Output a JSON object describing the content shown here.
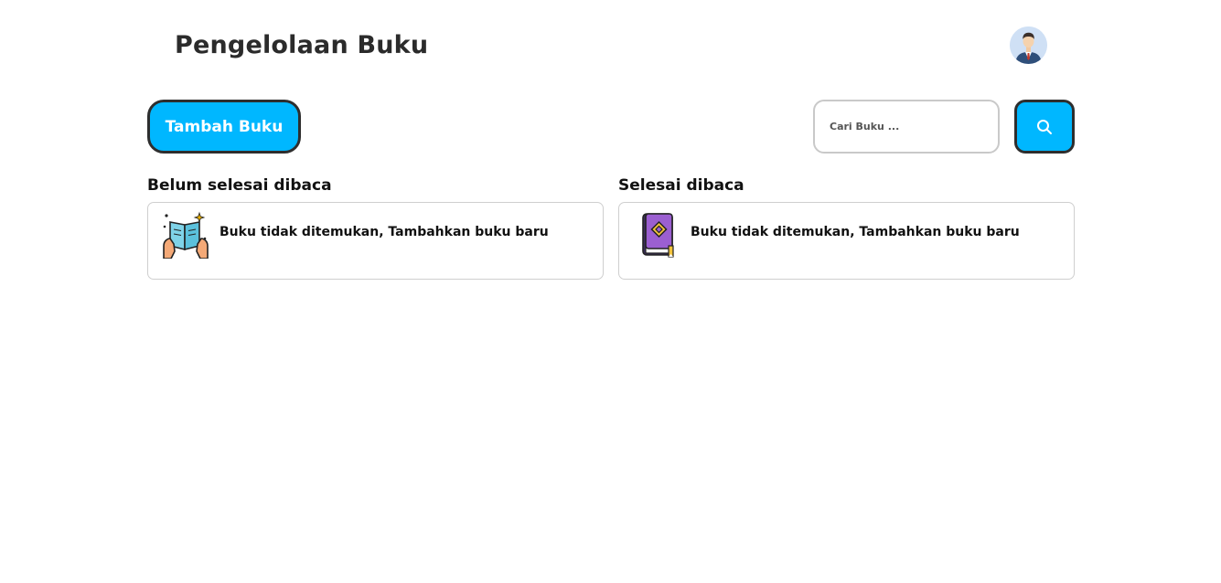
{
  "header": {
    "title": "Pengelolaan Buku",
    "avatar_icon": "user-avatar-icon"
  },
  "toolbar": {
    "add_label": "Tambah Buku",
    "search_placeholder": "Cari Buku ...",
    "search_value": "",
    "search_icon": "search-icon"
  },
  "sections": {
    "unread": {
      "title": "Belum selesai dibaca",
      "empty_text": "Buku tidak ditemukan, Tambahkan buku baru",
      "icon": "open-book-reading-icon"
    },
    "finished": {
      "title": "Selesai dibaca",
      "empty_text": "Buku tidak ditemukan, Tambahkan buku baru",
      "icon": "closed-book-icon"
    }
  },
  "colors": {
    "accent": "#00b7ff",
    "border_dark": "#2e2e2e",
    "card_border": "#cfcfcf"
  }
}
